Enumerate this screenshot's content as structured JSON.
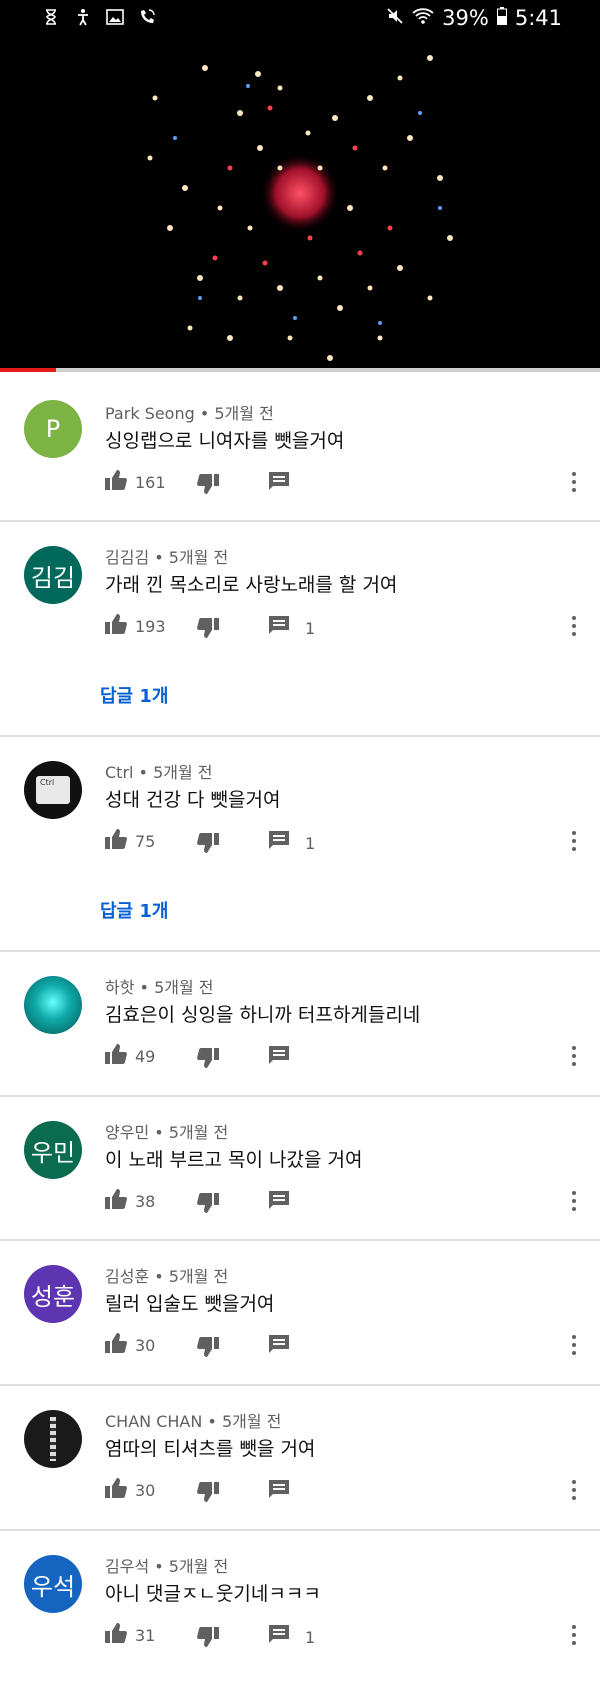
{
  "status": {
    "battery": "39%",
    "time": "5:41"
  },
  "comments": [
    {
      "author": "Park Seong",
      "age": "5개월 전",
      "text": "싱잉랩으로 니여자를 뺏을거여",
      "likes": "161",
      "reply_count": "",
      "avatar_text": "P",
      "avatar_color": "#7cb342"
    },
    {
      "author": "김김김",
      "age": "5개월 전",
      "text": "가래 낀 목소리로 사랑노래를 할 거여",
      "likes": "193",
      "reply_count": "1",
      "avatar_text": "김김",
      "avatar_color": "#00695c",
      "replies_label": "답글 1개"
    },
    {
      "author": "Ctrl",
      "age": "5개월 전",
      "text": "성대 건강 다 뺏을거여",
      "likes": "75",
      "reply_count": "1",
      "avatar_text": "",
      "avatar_color": "#111111",
      "replies_label": "답글 1개"
    },
    {
      "author": "하핫",
      "age": "5개월 전",
      "text": "김효은이 싱잉을 하니까 터프하게들리네",
      "likes": "49",
      "reply_count": "",
      "avatar_text": "",
      "avatar_color": "#0c5f6a"
    },
    {
      "author": "양우민",
      "age": "5개월 전",
      "text": "이 노래 부르고 목이 나갔을 거여",
      "likes": "38",
      "reply_count": "",
      "avatar_text": "우민",
      "avatar_color": "#0a6b4f"
    },
    {
      "author": "김성훈",
      "age": "5개월 전",
      "text": "릴러 입술도 뺏을거여",
      "likes": "30",
      "reply_count": "",
      "avatar_text": "성훈",
      "avatar_color": "#5e35b1"
    },
    {
      "author": "CHAN CHAN",
      "age": "5개월 전",
      "text": "염따의 티셔츠를 뺏을 거여",
      "likes": "30",
      "reply_count": "",
      "avatar_text": "",
      "avatar_color": "#1a1a1a"
    },
    {
      "author": "김우석",
      "age": "5개월 전",
      "text": "아니 댓글ㅈㄴ웃기네ㅋㅋㅋ",
      "likes": "31",
      "reply_count": "1",
      "avatar_text": "우석",
      "avatar_color": "#1565c0"
    }
  ],
  "colors": {
    "link": "#065fd4",
    "progress": "#e21b1b"
  }
}
